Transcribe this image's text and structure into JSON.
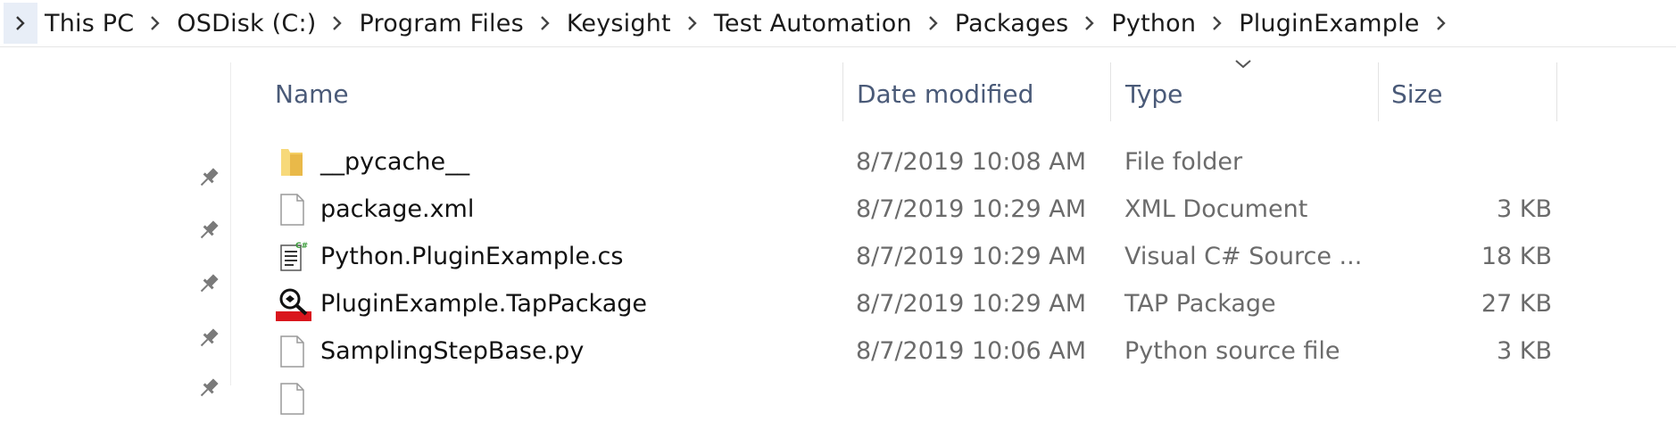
{
  "breadcrumb": {
    "items": [
      "This PC",
      "OSDisk (C:)",
      "Program Files",
      "Keysight",
      "Test Automation",
      "Packages",
      "Python",
      "PluginExample"
    ]
  },
  "columns": {
    "name": "Name",
    "date_modified": "Date modified",
    "type": "Type",
    "size": "Size"
  },
  "files": [
    {
      "name": "__pycache__",
      "date": "8/7/2019 10:08 AM",
      "type": "File folder",
      "size": "",
      "icon": "folder-icon"
    },
    {
      "name": "package.xml",
      "date": "8/7/2019 10:29 AM",
      "type": "XML Document",
      "size": "3 KB",
      "icon": "document-icon"
    },
    {
      "name": "Python.PluginExample.cs",
      "date": "8/7/2019 10:29 AM",
      "type": "Visual C# Source ...",
      "size": "18 KB",
      "icon": "csharp-file-icon"
    },
    {
      "name": "PluginExample.TapPackage",
      "date": "8/7/2019 10:29 AM",
      "type": "TAP Package",
      "size": "27 KB",
      "icon": "tap-package-icon"
    },
    {
      "name": "SamplingStepBase.py",
      "date": "8/7/2019 10:06 AM",
      "type": "Python source file",
      "size": "3 KB",
      "icon": "document-icon"
    }
  ],
  "colors": {
    "header_text": "#4a5a78",
    "secondary_text": "#6b6b6b",
    "folder": "#f0c24a",
    "tap_red": "#d9161d"
  }
}
